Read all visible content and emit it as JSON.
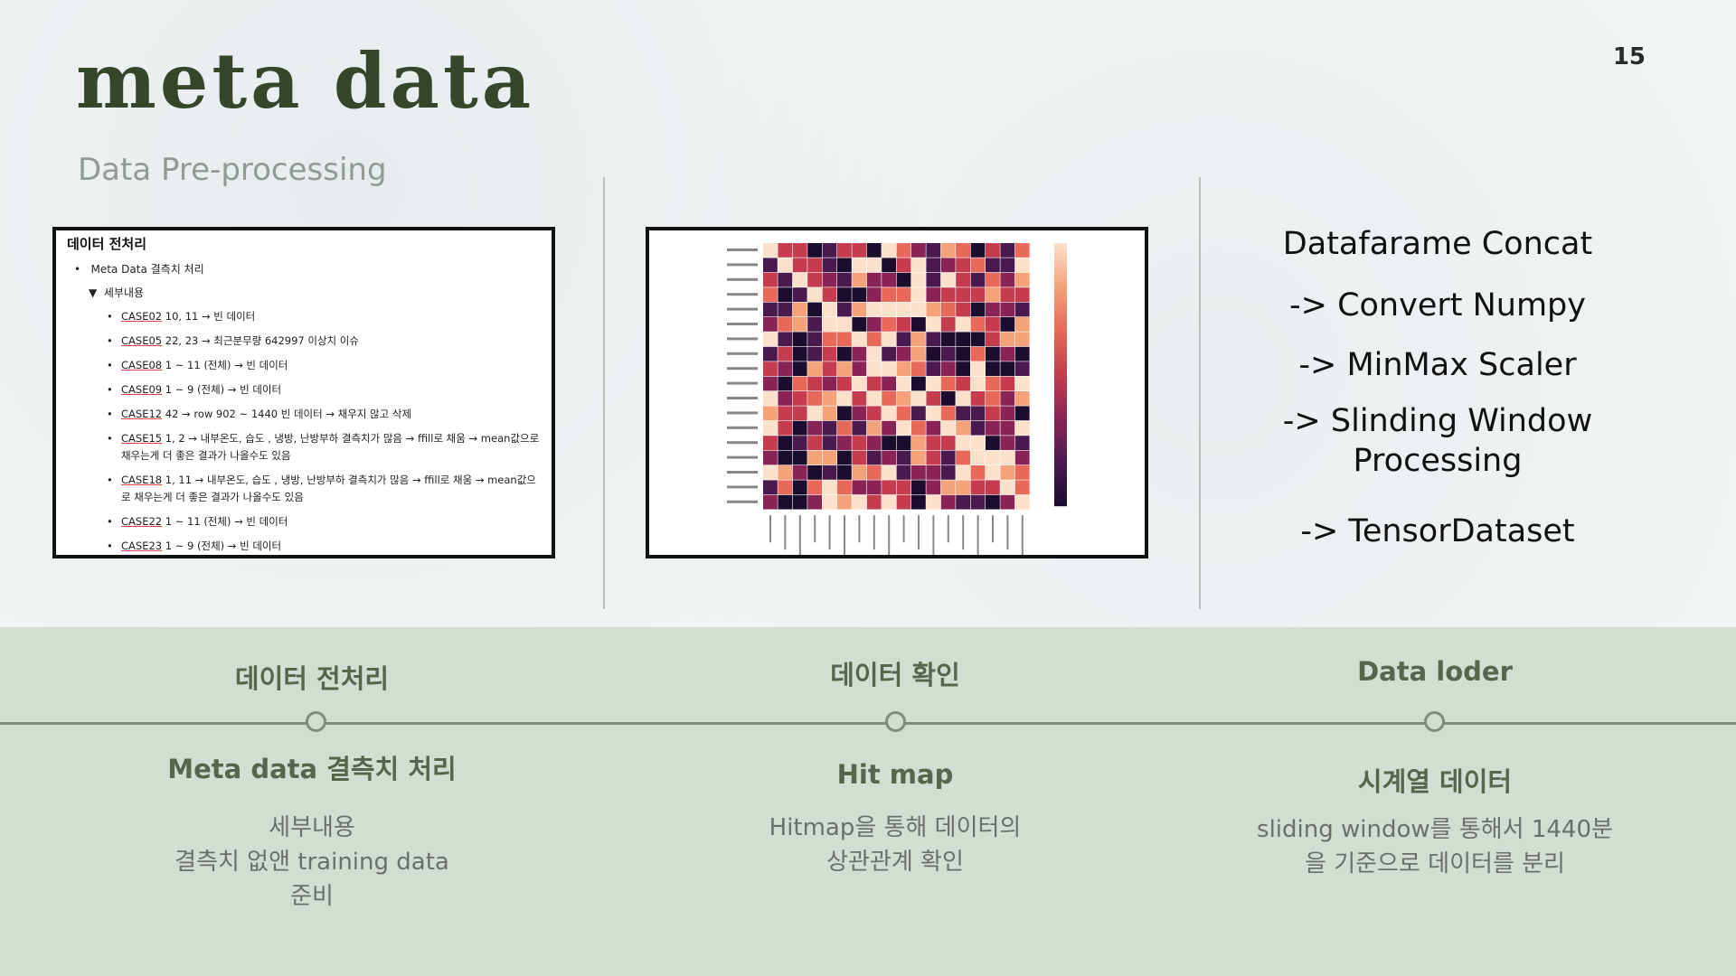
{
  "slide": {
    "page_number": "15",
    "title": "meta data",
    "subtitle": "Data Pre-processing"
  },
  "doc_panel": {
    "title": "데이터 전처리",
    "level1": "Meta Data 결측치 처리",
    "level2": "세부내용",
    "items": [
      {
        "case": "CASE02",
        "text": " 10, 11 → 빈 데이터"
      },
      {
        "case": "CASE05",
        "text": " 22, 23 → 최근분무량 642997 이상치 이슈"
      },
      {
        "case": "CASE08",
        "text": " 1 ~ 11 (전체) → 빈 데이터"
      },
      {
        "case": "CASE09",
        "text": " 1 ~ 9 (전체) → 빈 데이터"
      },
      {
        "case": "CASE12",
        "text": " 42 → row 902 ~ 1440 빈 데이터 → 채우지 않고 삭제"
      },
      {
        "case": "CASE15",
        "text": " 1, 2 → 내부온도, 습도 , 냉방, 난방부하 결측치가 많음 → ffill로 채움 → mean값으로 채우는게 더 좋은 결과가 나올수도 있음"
      },
      {
        "case": "CASE18",
        "text": " 1, 11 → 내부온도, 습도 , 냉방, 난방부하 결측치가 많음 → ffill로 채움 → mean값으로 채우는게 더 좋은 결과가 나올수도 있음"
      },
      {
        "case": "CASE22",
        "text": " 1 ~ 11 (전체) → 빈 데이터"
      },
      {
        "case": "CASE23",
        "text": " 1 ~ 9 (전체) → 빈 데이터"
      }
    ]
  },
  "heatmap": {
    "colors": [
      "#1a0d2e",
      "#4a1a4f",
      "#8a2456",
      "#c43c4e",
      "#e8685a",
      "#f4a27a",
      "#fbe0cc"
    ],
    "rows": 18,
    "cols": 18
  },
  "pipeline": {
    "steps": [
      "Datafarame Concat",
      "-> Convert Numpy",
      "-> MinMax Scaler",
      "-> Slinding Window\nProcessing",
      "-> TensorDataset"
    ]
  },
  "timeline": {
    "columns": [
      {
        "heading": "데이터 전처리",
        "subheading": "Meta data 결측치 처리",
        "description": "세부내용\n결측치 없앤 training data\n준비"
      },
      {
        "heading": "데이터 확인",
        "subheading": "Hit map",
        "description": "Hitmap을 통해 데이터의\n상관관계 확인"
      },
      {
        "heading": "Data loder",
        "subheading": "시계열 데이터",
        "description": "sliding window를 통해서 1440분\n을 기준으로 데이터를 분리"
      }
    ]
  }
}
